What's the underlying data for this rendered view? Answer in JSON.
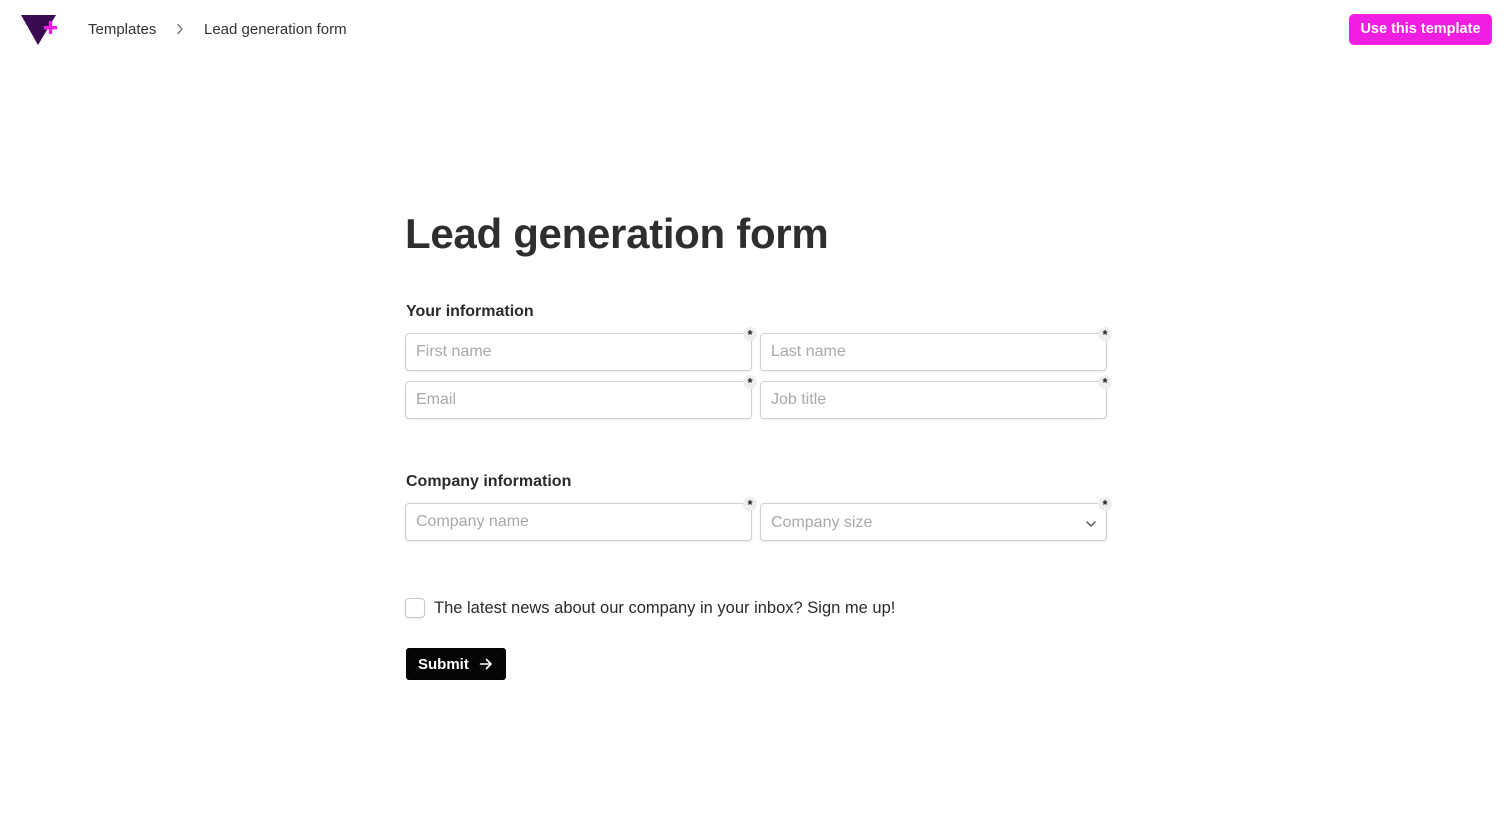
{
  "header": {
    "logo_icon": "triangle-plus-logo",
    "breadcrumb": {
      "root_label": "Templates",
      "separator_icon": "chevron-right-icon",
      "current_label": "Lead generation form"
    },
    "cta_label": "Use this template",
    "cta_color": "#f01ee0"
  },
  "form": {
    "title": "Lead generation form",
    "sections": {
      "your_info": {
        "title": "Your information",
        "fields": {
          "first_name": {
            "placeholder": "First name",
            "required_mark": "*"
          },
          "last_name": {
            "placeholder": "Last name",
            "required_mark": "*"
          },
          "email": {
            "placeholder": "Email",
            "required_mark": "*"
          },
          "job_title": {
            "placeholder": "Job title",
            "required_mark": "*"
          }
        }
      },
      "company_info": {
        "title": "Company information",
        "fields": {
          "company_name": {
            "placeholder": "Company name",
            "required_mark": "*"
          },
          "company_size": {
            "placeholder": "Company size",
            "required_mark": "*",
            "chevron_icon": "chevron-down-icon"
          }
        }
      }
    },
    "newsletter": {
      "label": "The latest news about our company in your inbox? Sign me up!",
      "checked": false
    },
    "submit": {
      "label": "Submit",
      "icon": "arrow-right-icon",
      "color": "#050505"
    }
  }
}
